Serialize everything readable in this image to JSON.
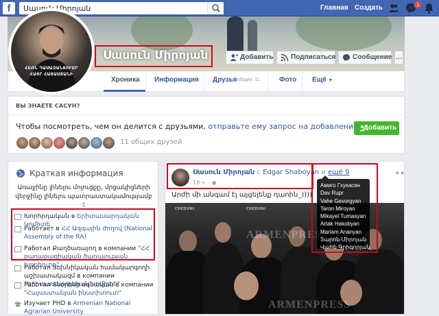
{
  "topbar": {
    "logo": "f",
    "search_value": "Սասուն Միրոյան",
    "home": "Главная",
    "create": "Создать",
    "notifications_count": "1",
    "icons": [
      "search-icon",
      "friends-icon",
      "messenger-icon",
      "bell-icon"
    ]
  },
  "profile": {
    "name": "Սասուն Միրոյան",
    "avatar_caption_1": "ՀԵՌՆ ԴԱՍԱԶԱՆՑՈՒՄՐ",
    "avatar_caption_2": "ՀԱՅՐ ՀԱՅԱՍՏԱՆԻ",
    "add_friend": "Добавить",
    "follow": "Подписаться",
    "message": "Сообщение",
    "tabs": {
      "timeline": "Хроника",
      "about": "Информация",
      "friends": "Друзья",
      "friends_common": "общие: 11",
      "photos": "Фото",
      "more": "Ещё"
    }
  },
  "pymk": {
    "title": "ВЫ ЗНАЕТЕ САСУН?",
    "text_before": "Чтобы посмотреть, чем он делится с друзьями, ",
    "text_link": "отправьте ему запрос на добавление в друзья.",
    "add": "Добавить",
    "mutual": "11 общих друзей"
  },
  "intro": {
    "title": "Краткая информация",
    "bio": "Առաջինը լինելու մոլուցքը, մրցակիցների վերջինը լինելու պատրաստակամությամբ ✌",
    "items": [
      {
        "text": "Խորհրդական в ",
        "link": "Երիտասարդական Կոմիտե",
        "icon": "briefcase-icon"
      },
      {
        "text": "Работает в ",
        "link": "ՀՀ Ազգային ժողով (National Assembly of the RA)",
        "icon": "briefcase-icon"
      },
      {
        "text": "Работал Քաղծառայող в компании ",
        "link": "\"ՀՀ քաղաքացիական ծառայության խորհուրդ\"",
        "icon": "briefcase-icon"
      },
      {
        "text": "Работал Տեխնիկական համակարգողի աշխատակազմ в компании ",
        "link": "\"Երիտասարդական Կոմիտե\"",
        "icon": "briefcase-icon"
      },
      {
        "text": "Работал Տնօրենի օգնական в компании ",
        "link": "\"Հայաստանյան ինստիտուտ\"",
        "icon": "briefcase-icon"
      },
      {
        "text": "Изучает PHD в ",
        "link": "Armenian National Agrarian University",
        "icon": "graduation-cap-icon"
      }
    ]
  },
  "post": {
    "author": "Սասուն Միրոյան",
    "with": "с",
    "tagged": "Edgar Shaboyan",
    "and": "и",
    "others_link": "ещё 9",
    "time": "18 ч.",
    "text": "Արժի մի անգամ էլ այցելենք դաոին_))))",
    "watermark": "ARMENPRESS",
    "sign_text": "CREDUNI",
    "more": "•••"
  },
  "tooltip": {
    "names": [
      "Амиго Гхукасян",
      "Dav Rupr",
      "Vahe Gevorgyan",
      "Taron Miroyan",
      "Mikayel Tumasyan",
      "Artak Hakobyan",
      "Mariam Ananyan",
      "Sարոն Միրոյան",
      "Վահե Գրիգորյան"
    ]
  },
  "colors": {
    "brand": "#4267b2",
    "link": "#365899",
    "green": "#42b72a",
    "highlight": "#d0021b"
  }
}
